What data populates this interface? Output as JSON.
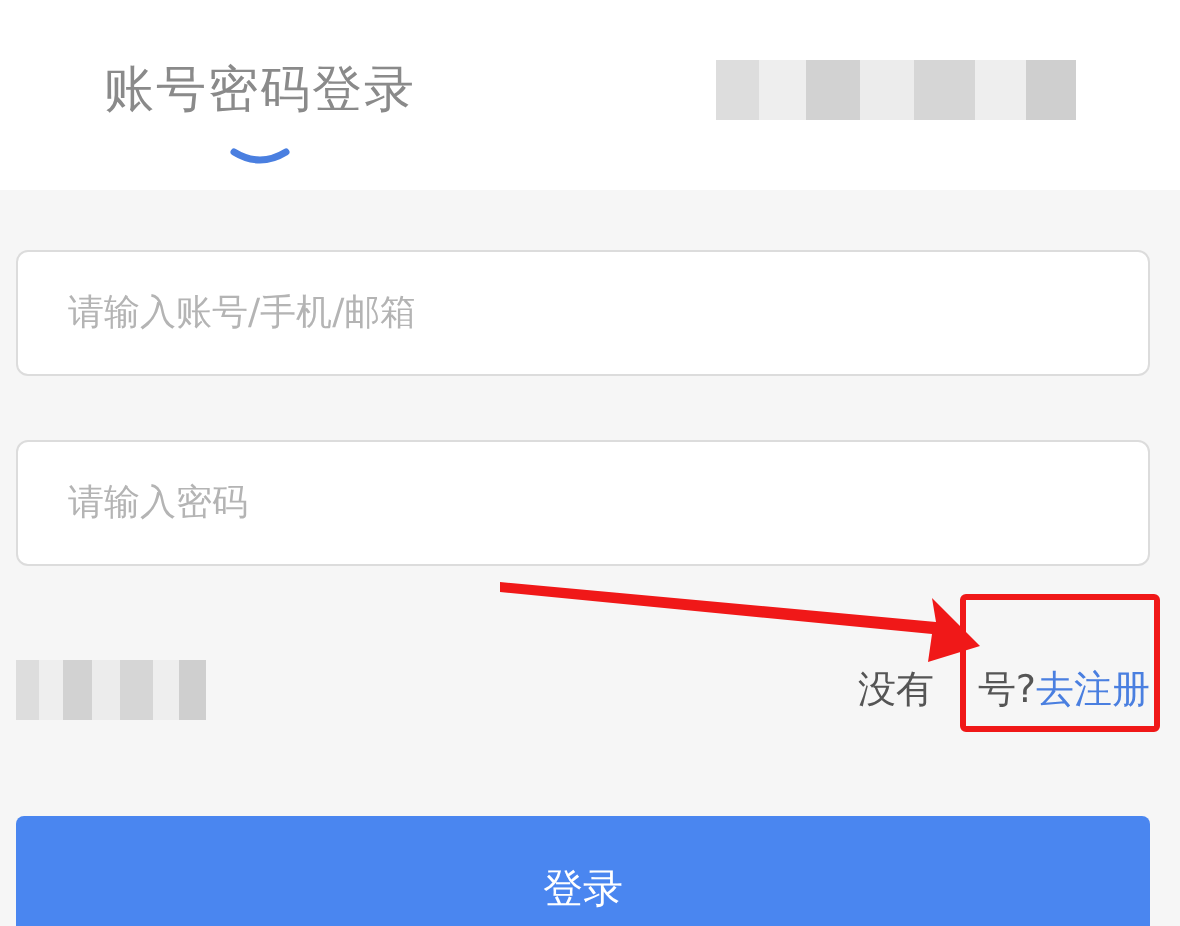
{
  "tab": {
    "label": "账号密码登录",
    "selected": true
  },
  "fields": [
    {
      "placeholder": "请输入账号/手机/邮箱"
    },
    {
      "placeholder": "请输入密码"
    }
  ],
  "register": {
    "prompt_parts": [
      "没有",
      "号?"
    ],
    "link": "去注册"
  },
  "login_button": "登录"
}
